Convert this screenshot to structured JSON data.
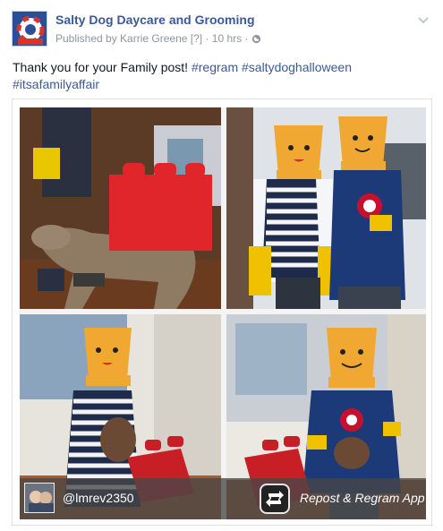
{
  "post": {
    "page_name": "Salty Dog Daycare and Grooming",
    "published_by": "Published by Karrie Greene",
    "help_marker": "[?]",
    "time": "10 hrs",
    "separator": "·",
    "text": "Thank you for your Family post!",
    "hashtags": [
      "#regram",
      "#saltydoghalloween",
      "#itsafamilyaffair"
    ]
  },
  "overlay": {
    "username": "@lmrev2350",
    "app_label": "Repost & Regram App"
  },
  "icons": {
    "chevron": "chevron-down-icon",
    "audience": "globe-icon",
    "app": "repost-app-icon"
  },
  "colors": {
    "link": "#3b5998",
    "meta": "#90949c",
    "text": "#141823",
    "lego_red": "#e0262b",
    "lego_yellow": "#f0a832"
  }
}
